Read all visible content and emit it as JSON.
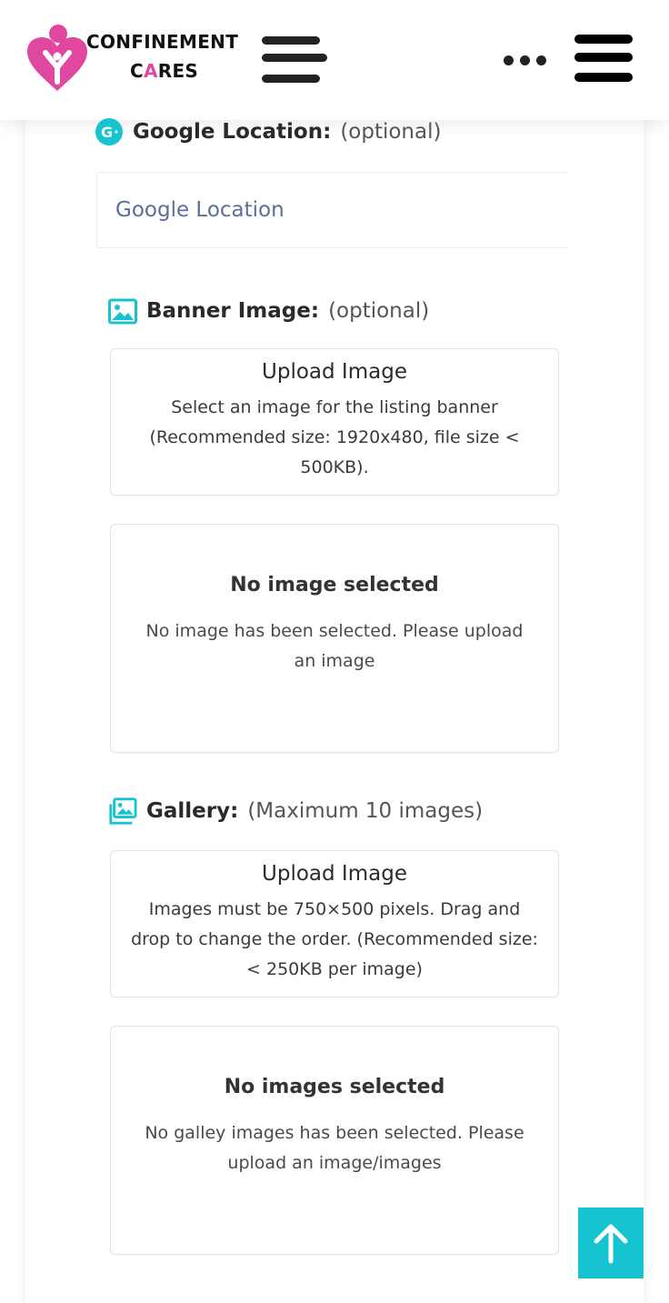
{
  "brand": {
    "line1": "CONFINEMENT",
    "line2_prefix": "C",
    "line2_accent": "A",
    "line2_suffix": "RES",
    "logo_color": "#e0479e",
    "accent_color": "#15c4cf"
  },
  "header": {
    "menu_icon": "hamburger-icon",
    "more_icon": "ellipsis-icon"
  },
  "google_location": {
    "icon": "google-icon",
    "label": "Google Location:",
    "note": "(optional)",
    "placeholder": "Google Location",
    "value": ""
  },
  "banner_image": {
    "icon": "image-icon",
    "label": "Banner Image:",
    "note": "(optional)",
    "upload_title": "Upload Image",
    "upload_desc": "Select an image for the listing banner (Recommended size: 1920x480, file size < 500KB).",
    "empty_title": "No image selected",
    "empty_desc": "No image has been selected. Please upload an image"
  },
  "gallery": {
    "icon": "images-icon",
    "label": "Gallery:",
    "note": "(Maximum 10 images)",
    "upload_title": "Upload Image",
    "upload_desc": "Images must be 750×500 pixels. Drag and drop to change the order. (Recommended size: < 250KB per image)",
    "empty_title": "No images selected",
    "empty_desc": "No galley images has been selected. Please upload an image/images"
  },
  "scroll_top": {
    "icon": "arrow-up-icon"
  }
}
